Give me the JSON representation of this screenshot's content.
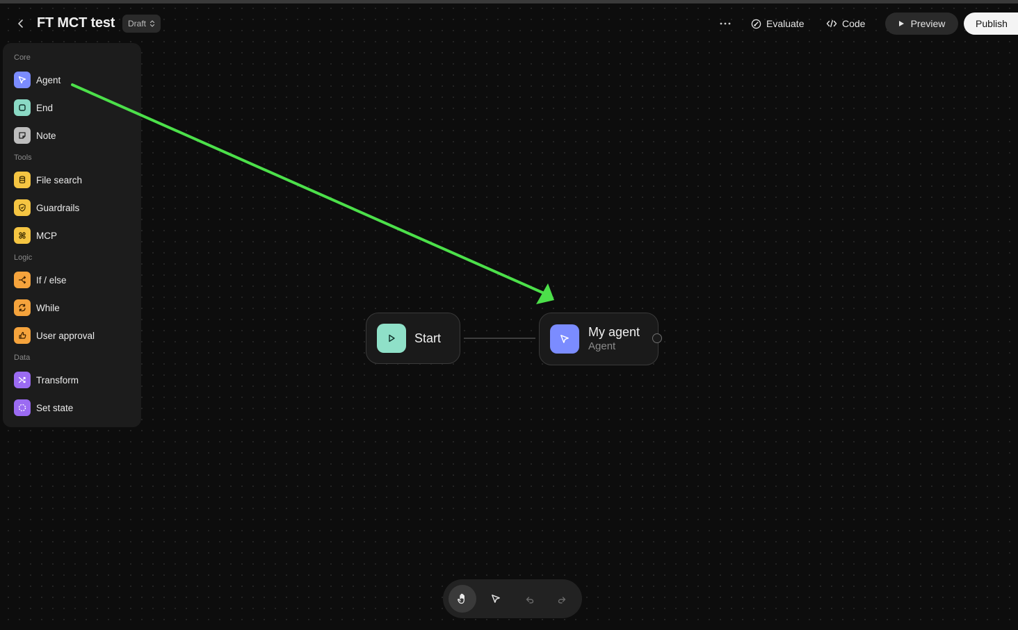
{
  "header": {
    "title": "FT MCT test",
    "status_badge": "Draft",
    "evaluate_label": "Evaluate",
    "code_label": "Code",
    "preview_label": "Preview",
    "publish_label": "Publish"
  },
  "sidebar": {
    "sections": [
      {
        "label": "Core",
        "items": [
          {
            "label": "Agent",
            "icon": "agent-cursor-icon",
            "color": "#7b8cff"
          },
          {
            "label": "End",
            "icon": "end-square-icon",
            "color": "#8ad9c4"
          },
          {
            "label": "Note",
            "icon": "note-icon",
            "color": "#bdbdbd"
          }
        ]
      },
      {
        "label": "Tools",
        "items": [
          {
            "label": "File search",
            "icon": "file-search-icon",
            "color": "#f5c542"
          },
          {
            "label": "Guardrails",
            "icon": "shield-icon",
            "color": "#f5c542"
          },
          {
            "label": "MCP",
            "icon": "mcp-icon",
            "color": "#f5c542"
          }
        ]
      },
      {
        "label": "Logic",
        "items": [
          {
            "label": "If / else",
            "icon": "branch-icon",
            "color": "#f5a33c"
          },
          {
            "label": "While",
            "icon": "loop-icon",
            "color": "#f5a33c"
          },
          {
            "label": "User approval",
            "icon": "approval-icon",
            "color": "#f5a33c"
          }
        ]
      },
      {
        "label": "Data",
        "items": [
          {
            "label": "Transform",
            "icon": "transform-icon",
            "color": "#9b6bf2"
          },
          {
            "label": "Set state",
            "icon": "set-state-icon",
            "color": "#9b6bf2"
          }
        ]
      }
    ]
  },
  "canvas": {
    "start_node": {
      "label": "Start",
      "color": "#8fe0c8"
    },
    "agent_node": {
      "name": "My agent",
      "type": "Agent",
      "color": "#7b8cff"
    },
    "annotation_arrow_color": "#4ce04a"
  },
  "toolbar": {
    "tools": [
      {
        "icon": "hand-icon",
        "active": true
      },
      {
        "icon": "pointer-icon",
        "active": false
      },
      {
        "icon": "undo-icon",
        "active": false
      },
      {
        "icon": "redo-icon",
        "active": false
      }
    ]
  }
}
